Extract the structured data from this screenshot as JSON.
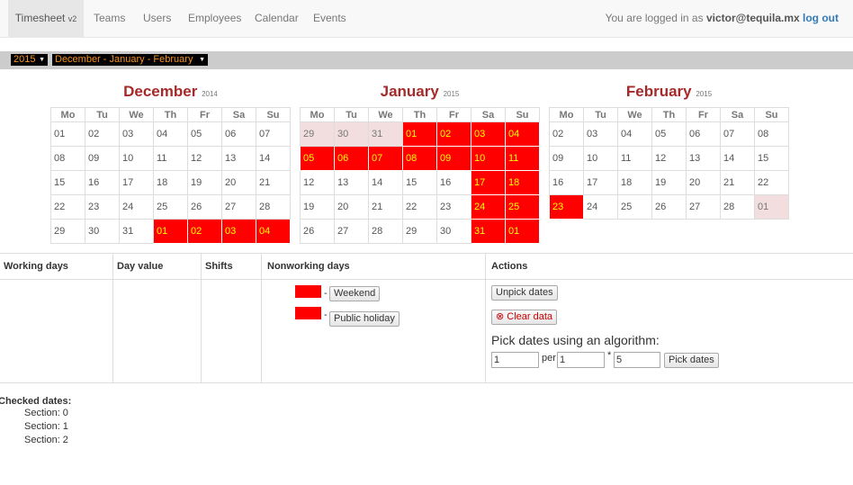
{
  "navbar": {
    "brand": "Timesheet",
    "brand_version": "v2",
    "links": [
      "Teams",
      "Users",
      "Employees",
      "Calendar",
      "Events"
    ],
    "logged_in_prefix": "You are logged in as",
    "user": "victor@tequila.mx",
    "logout": "log out"
  },
  "selectors": {
    "year": "2015",
    "range": "December - January - February"
  },
  "weekdays": [
    "Mo",
    "Tu",
    "We",
    "Th",
    "Fr",
    "Sa",
    "Su"
  ],
  "calendars": [
    {
      "month": "December",
      "year": "2014",
      "weeks": [
        [
          [
            "01",
            ""
          ],
          [
            "02",
            ""
          ],
          [
            "03",
            ""
          ],
          [
            "04",
            ""
          ],
          [
            "05",
            ""
          ],
          [
            "06",
            ""
          ],
          [
            "07",
            ""
          ]
        ],
        [
          [
            "08",
            ""
          ],
          [
            "09",
            ""
          ],
          [
            "10",
            ""
          ],
          [
            "11",
            ""
          ],
          [
            "12",
            ""
          ],
          [
            "13",
            ""
          ],
          [
            "14",
            ""
          ]
        ],
        [
          [
            "15",
            ""
          ],
          [
            "16",
            ""
          ],
          [
            "17",
            ""
          ],
          [
            "18",
            ""
          ],
          [
            "19",
            ""
          ],
          [
            "20",
            ""
          ],
          [
            "21",
            ""
          ]
        ],
        [
          [
            "22",
            ""
          ],
          [
            "23",
            ""
          ],
          [
            "24",
            ""
          ],
          [
            "25",
            ""
          ],
          [
            "26",
            ""
          ],
          [
            "27",
            ""
          ],
          [
            "28",
            ""
          ]
        ],
        [
          [
            "29",
            ""
          ],
          [
            "30",
            ""
          ],
          [
            "31",
            ""
          ],
          [
            "01",
            "red"
          ],
          [
            "02",
            "red"
          ],
          [
            "03",
            "red"
          ],
          [
            "04",
            "red"
          ]
        ]
      ]
    },
    {
      "month": "January",
      "year": "2015",
      "weeks": [
        [
          [
            "29",
            "pink"
          ],
          [
            "30",
            "pink"
          ],
          [
            "31",
            "pink"
          ],
          [
            "01",
            "red"
          ],
          [
            "02",
            "red"
          ],
          [
            "03",
            "red"
          ],
          [
            "04",
            "red"
          ]
        ],
        [
          [
            "05",
            "red"
          ],
          [
            "06",
            "red"
          ],
          [
            "07",
            "red"
          ],
          [
            "08",
            "red"
          ],
          [
            "09",
            "red"
          ],
          [
            "10",
            "red"
          ],
          [
            "11",
            "red"
          ]
        ],
        [
          [
            "12",
            ""
          ],
          [
            "13",
            ""
          ],
          [
            "14",
            ""
          ],
          [
            "15",
            ""
          ],
          [
            "16",
            ""
          ],
          [
            "17",
            "red"
          ],
          [
            "18",
            "red"
          ]
        ],
        [
          [
            "19",
            ""
          ],
          [
            "20",
            ""
          ],
          [
            "21",
            ""
          ],
          [
            "22",
            ""
          ],
          [
            "23",
            ""
          ],
          [
            "24",
            "red"
          ],
          [
            "25",
            "red"
          ]
        ],
        [
          [
            "26",
            ""
          ],
          [
            "27",
            ""
          ],
          [
            "28",
            ""
          ],
          [
            "29",
            ""
          ],
          [
            "30",
            ""
          ],
          [
            "31",
            "red"
          ],
          [
            "01",
            "red"
          ]
        ]
      ]
    },
    {
      "month": "February",
      "year": "2015",
      "weeks": [
        [
          [
            "02",
            ""
          ],
          [
            "03",
            ""
          ],
          [
            "04",
            ""
          ],
          [
            "05",
            ""
          ],
          [
            "06",
            ""
          ],
          [
            "07",
            ""
          ],
          [
            "08",
            ""
          ]
        ],
        [
          [
            "09",
            ""
          ],
          [
            "10",
            ""
          ],
          [
            "11",
            ""
          ],
          [
            "12",
            ""
          ],
          [
            "13",
            ""
          ],
          [
            "14",
            ""
          ],
          [
            "15",
            ""
          ]
        ],
        [
          [
            "16",
            ""
          ],
          [
            "17",
            ""
          ],
          [
            "18",
            ""
          ],
          [
            "19",
            ""
          ],
          [
            "20",
            ""
          ],
          [
            "21",
            ""
          ],
          [
            "22",
            ""
          ]
        ],
        [
          [
            "23",
            "red"
          ],
          [
            "24",
            ""
          ],
          [
            "25",
            ""
          ],
          [
            "26",
            ""
          ],
          [
            "27",
            ""
          ],
          [
            "28",
            ""
          ],
          [
            "01",
            "pink"
          ]
        ]
      ]
    }
  ],
  "table": {
    "headers": [
      "Working days",
      "Day value",
      "Shifts",
      "Nonworking days",
      "Actions"
    ],
    "legend": [
      {
        "dash": "-",
        "label": "Weekend"
      },
      {
        "dash": "-",
        "label": "Public holiday"
      }
    ],
    "actions": {
      "unpick": "Unpick dates",
      "clear": "Clear data",
      "clear_icon": "⊗",
      "algo_label": "Pick dates using an algorithm:",
      "input1": "1",
      "per": "per",
      "input2": "1",
      "times": "*",
      "input3": "5",
      "pick": "Pick dates"
    }
  },
  "checked": {
    "heading": "Checked dates:",
    "sections": [
      "Section: 0",
      "Section: 1",
      "Section: 2"
    ]
  },
  "colors": {
    "highlight": "#ff0000",
    "highlight_text": "#ffff00",
    "month_title": "#a52a2a",
    "prev_month": "#f2dede"
  }
}
